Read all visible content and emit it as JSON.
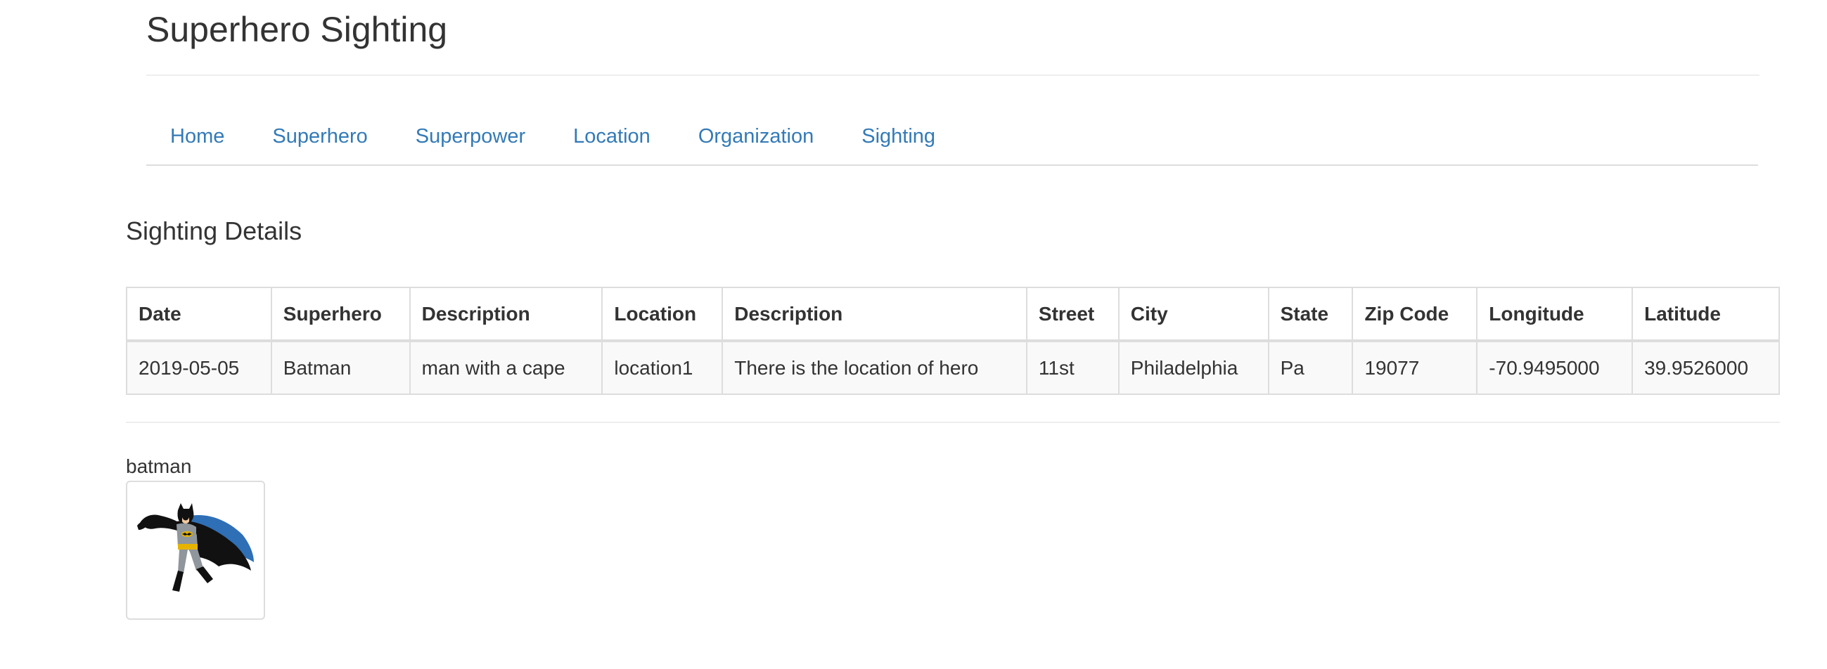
{
  "header": {
    "title": "Superhero Sighting"
  },
  "nav": {
    "items": [
      {
        "label": "Home"
      },
      {
        "label": "Superhero"
      },
      {
        "label": "Superpower"
      },
      {
        "label": "Location"
      },
      {
        "label": "Organization"
      },
      {
        "label": "Sighting"
      }
    ],
    "link_color": "#337ab7"
  },
  "main": {
    "section_title": "Sighting Details",
    "table": {
      "columns": [
        "Date",
        "Superhero",
        "Description",
        "Location",
        "Description",
        "Street",
        "City",
        "State",
        "Zip Code",
        "Longitude",
        "Latitude"
      ],
      "rows": [
        [
          "2019-05-05",
          "Batman",
          "man with a cape",
          "location1",
          "There is the location of hero",
          "11st",
          "Philadelphia",
          "Pa",
          "19077",
          "-70.9495000",
          "39.9526000"
        ]
      ]
    },
    "hero": {
      "name": "batman",
      "image_icon": "batman-image"
    }
  }
}
